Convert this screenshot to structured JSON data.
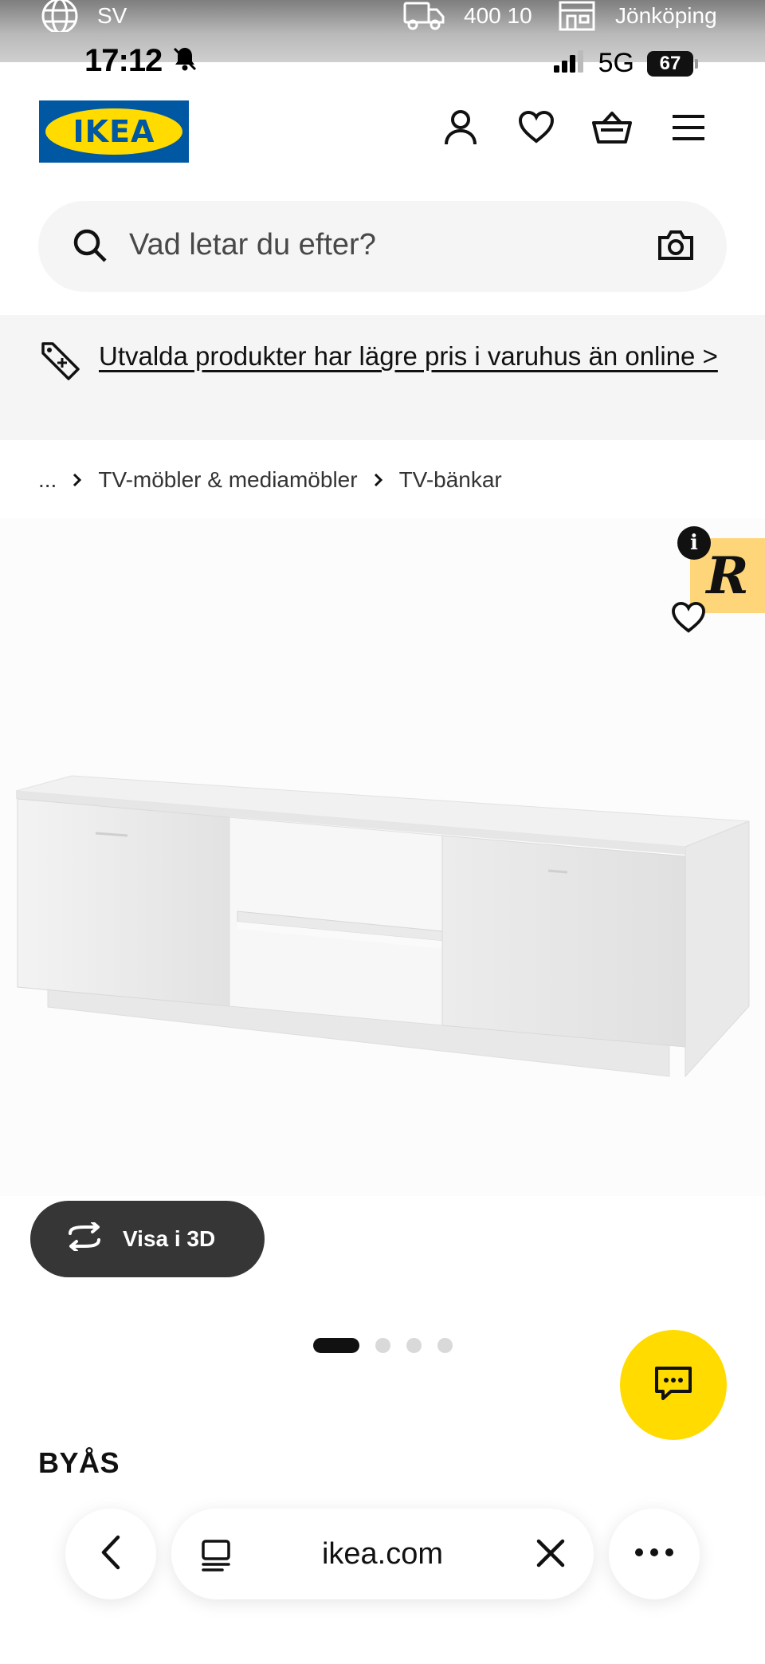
{
  "status_bar": {
    "language": "SV",
    "postal_code": "400 10",
    "store": "Jönköping",
    "time": "17:12",
    "network": "5G",
    "battery": "67"
  },
  "header": {
    "logo_text": "IKEA"
  },
  "search": {
    "placeholder": "Vad letar du efter?"
  },
  "promo": {
    "text": "Utvalda produkter har lägre pris i varuhus än online >"
  },
  "breadcrumb": {
    "ellipsis": "...",
    "items": [
      "TV-möbler & mediamöbler",
      "TV-bänkar"
    ]
  },
  "overlay": {
    "info": "i",
    "badge": "R"
  },
  "product": {
    "view_3d_label": "Visa i 3D",
    "carousel_total": 4,
    "carousel_active": 1,
    "name": "BYÅS"
  },
  "browser": {
    "url": "ikea.com"
  },
  "colors": {
    "ikea_blue": "#0058a3",
    "ikea_yellow": "#ffdb00",
    "dark_button": "#363636"
  }
}
